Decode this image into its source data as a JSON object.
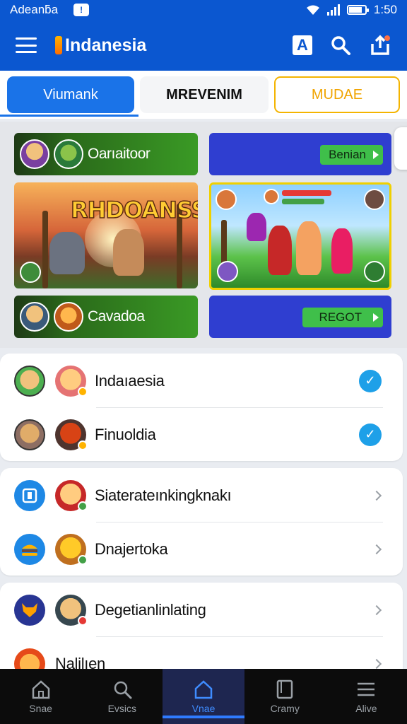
{
  "status_bar": {
    "carrier": "Adeanƃa",
    "notification": "!",
    "time": "1:50",
    "battery_level": 0.8
  },
  "app_bar": {
    "title": "Indanesia",
    "icons": [
      "menu-icon",
      "translate-icon",
      "search-icon",
      "share-icon"
    ],
    "translate_label": "A"
  },
  "tabs": [
    {
      "label": "Viumank",
      "active": true
    },
    {
      "label": "MREVENIM",
      "active": false
    },
    {
      "label": "MUDAE",
      "active": false
    }
  ],
  "featured": {
    "left": {
      "top_label": "Oarıaitoor",
      "game_title": "RHDOANSS",
      "bottom_label": "Cavadoa"
    },
    "right": {
      "top_button": "Benian",
      "bottom_button": "REGOT"
    }
  },
  "section1": [
    {
      "label": "Indaıaesia",
      "action": "check-icon"
    },
    {
      "label": "Finuoldia",
      "action": "check-icon"
    }
  ],
  "section2": [
    {
      "label": "Siaterateınkingknakı",
      "action": "chevron-right-icon"
    },
    {
      "label": "Dnajertoka",
      "action": "chevron-right-icon"
    }
  ],
  "section3": [
    {
      "label": "Degetianlinlating",
      "action": "chevron-right-icon"
    },
    {
      "label": "Nalilıen",
      "action": "chevron-right-icon"
    }
  ],
  "bottom_nav": [
    {
      "label": "Snae",
      "icon": "home-outline-icon",
      "active": false
    },
    {
      "label": "Evsics",
      "icon": "search-icon",
      "active": false
    },
    {
      "label": "Vnae",
      "icon": "home-icon",
      "active": true
    },
    {
      "label": "Cramy",
      "icon": "tablet-icon",
      "active": false
    },
    {
      "label": "Alive",
      "icon": "menu-icon",
      "active": false
    }
  ],
  "colors": {
    "primary": "#0b57d0",
    "tab_active": "#1a73e8",
    "tab_outline": "#f4b400",
    "green_card": "#3a9a25",
    "blue_card": "#2f3ed0",
    "check": "#1ea0e8",
    "nav_active": "#3f8cff"
  }
}
